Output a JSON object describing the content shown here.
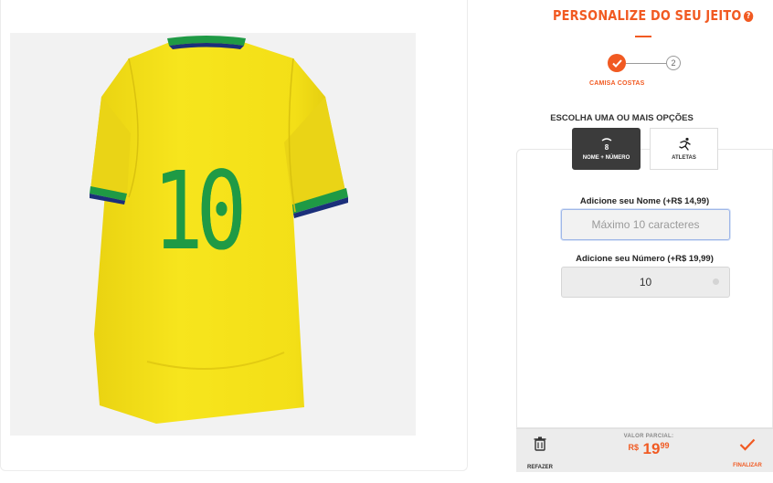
{
  "header": {
    "title": "PERSONALIZE DO SEU JEITO",
    "help_icon": "question-circle-icon"
  },
  "steps": {
    "step1_label": "CAMISA COSTAS",
    "step2_number": "2"
  },
  "options": {
    "heading": "ESCOLHA UMA OU MAIS OPÇÕES",
    "name_number_label": "NOME + NÚMERO",
    "athletes_label": "ATLETAS"
  },
  "form": {
    "name_label": "Adicione seu Nome (+R$ 14,99)",
    "name_placeholder": "Máximo 10 caracteres",
    "name_value": "",
    "number_label": "Adicione seu Número (+R$ 19,99)",
    "number_value": "10"
  },
  "footer": {
    "undo_label": "REFAZER",
    "partial_label": "VALOR PARCIAL:",
    "currency": "R$",
    "price_int": "19",
    "price_cents": "99",
    "finish_label": "FINALIZAR"
  },
  "jersey": {
    "number": "10"
  },
  "colors": {
    "accent": "#f15a22",
    "jersey_yellow": "#f4e11a",
    "jersey_green": "#1f9a45",
    "jersey_navy": "#1b2f7a"
  }
}
